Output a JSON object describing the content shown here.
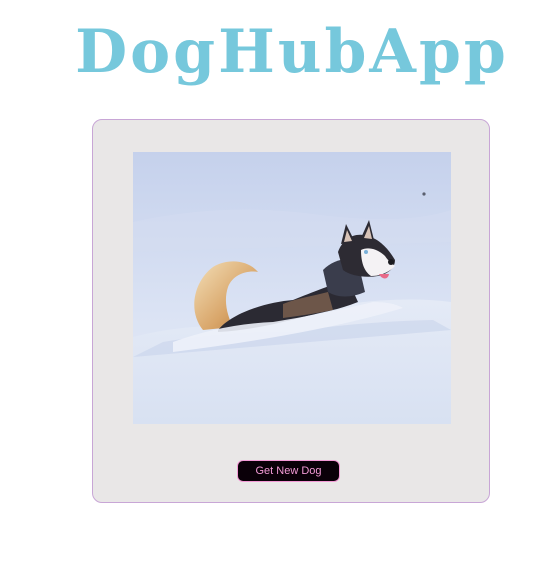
{
  "header": {
    "title": "DogHubApp"
  },
  "card": {
    "button_label": "Get New Dog"
  },
  "image": {
    "subject": "husky dog running through snow"
  },
  "colors": {
    "title": "#76c8dc",
    "card_background": "#e9e7e7",
    "card_border": "#c8a6d6",
    "button_background": "#0a0008",
    "button_text": "#f39ad6",
    "button_border": "#f39ad6"
  }
}
